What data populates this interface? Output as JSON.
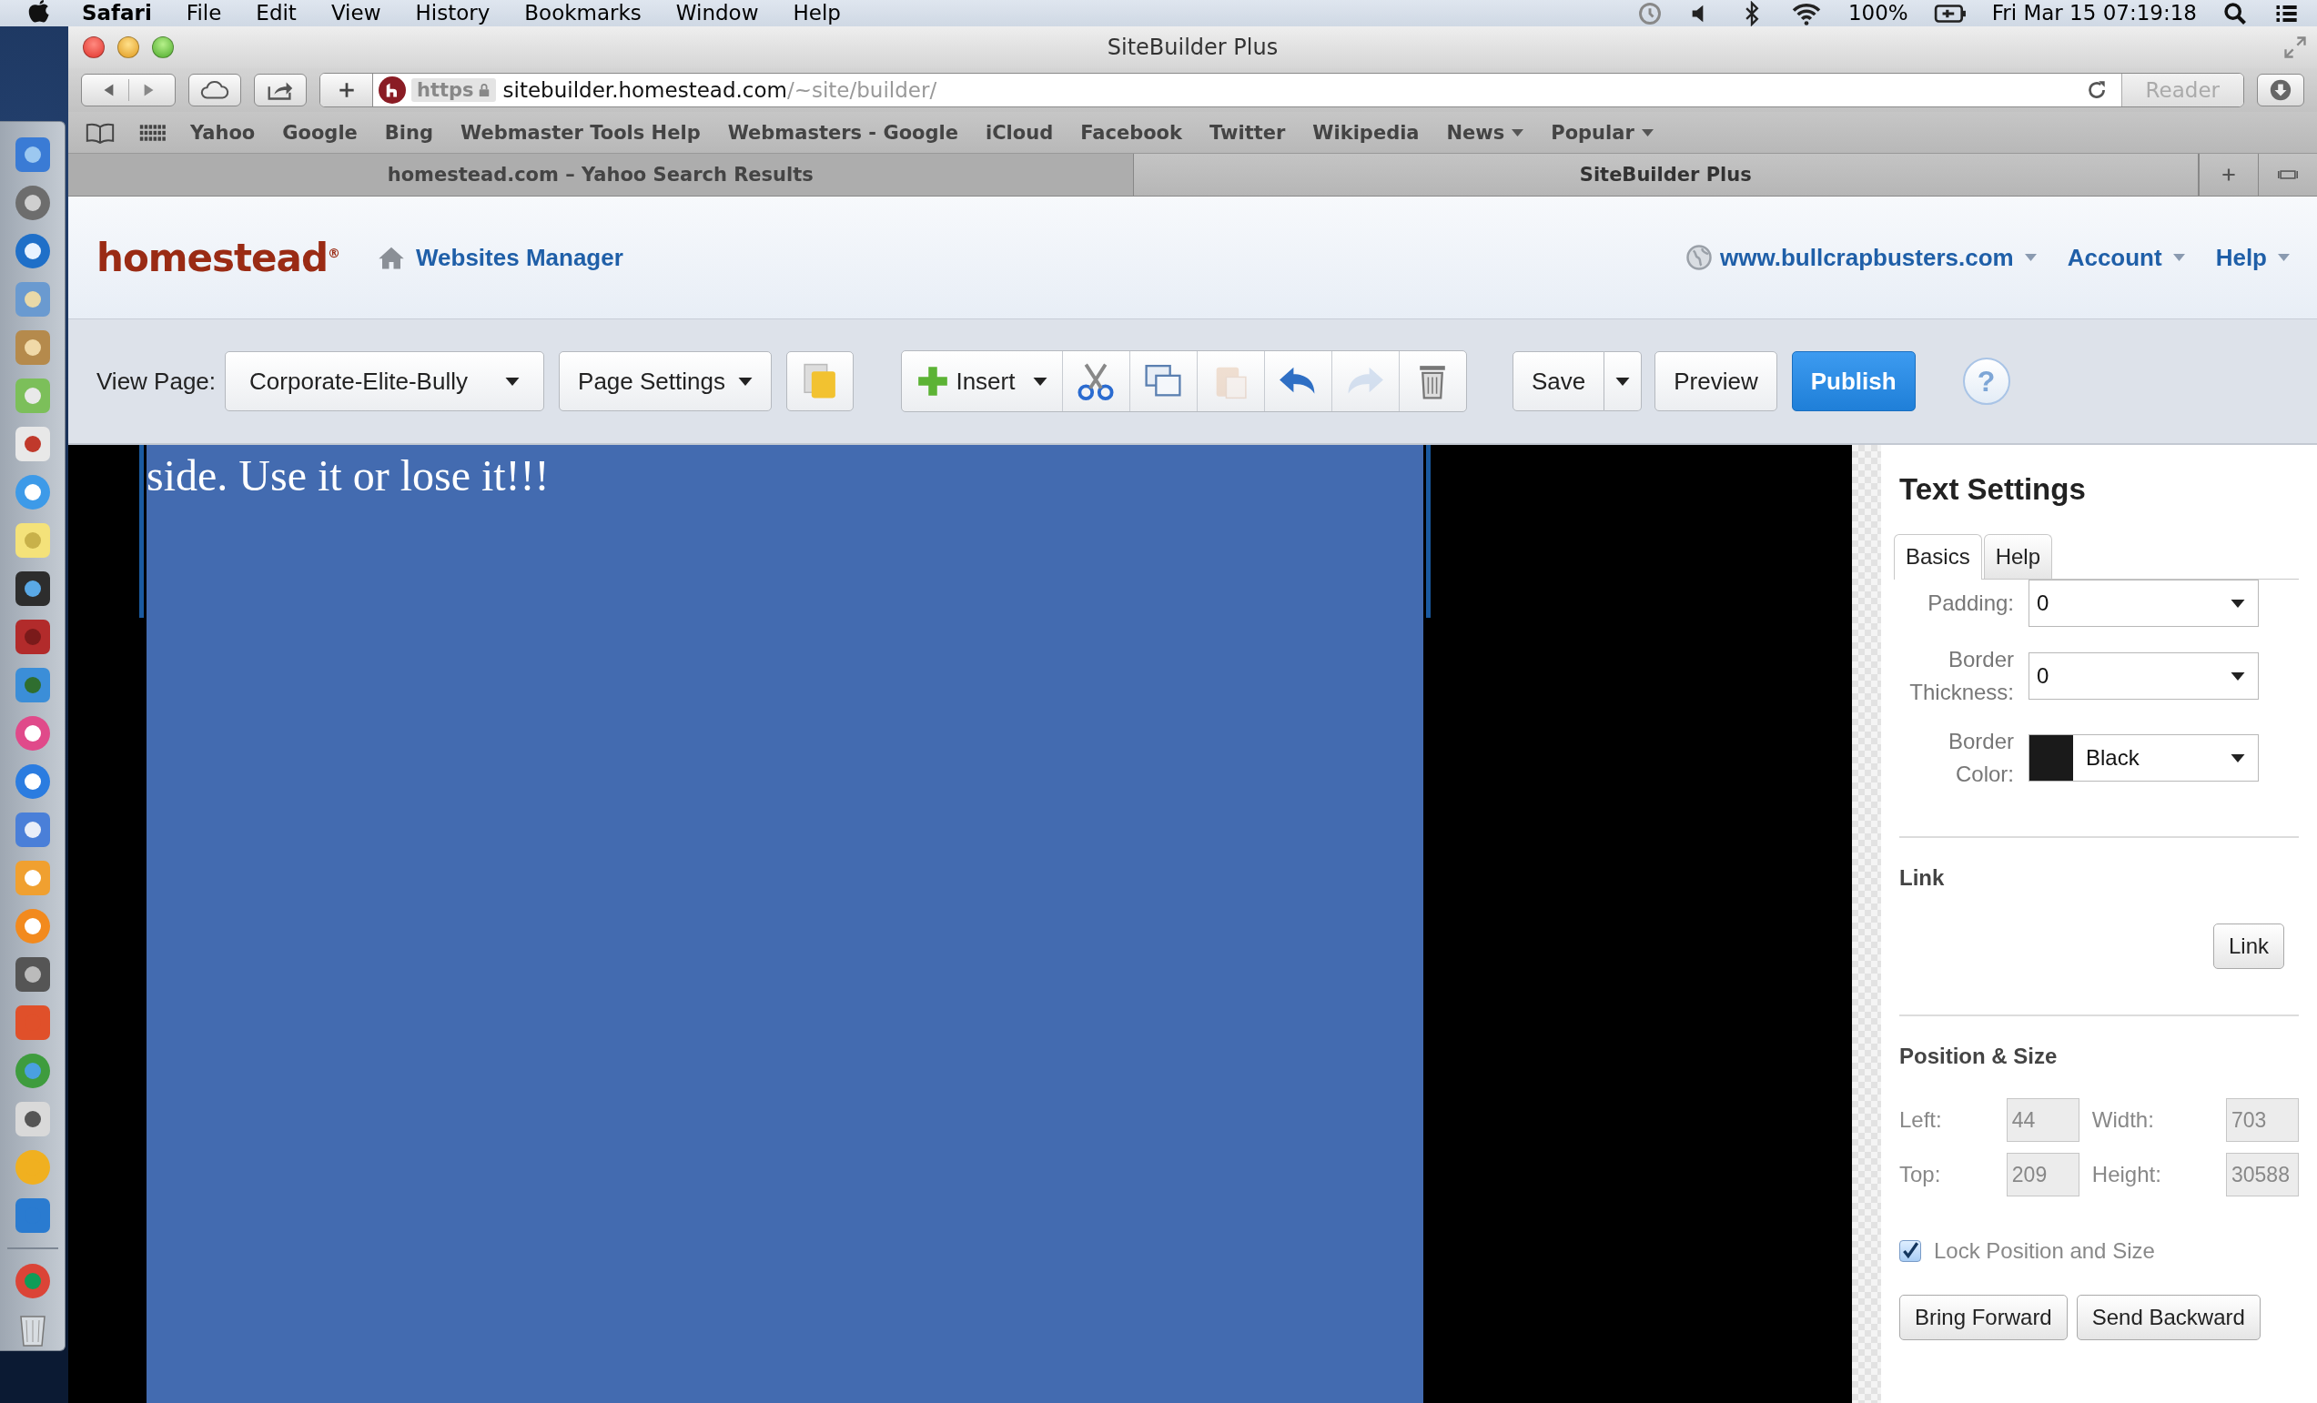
{
  "menu_bar": {
    "app": "Safari",
    "menus": [
      "File",
      "Edit",
      "View",
      "History",
      "Bookmarks",
      "Window",
      "Help"
    ],
    "battery": "100%",
    "clock": "Fri Mar 15  07:19:18"
  },
  "window": {
    "title": "SiteBuilder Plus"
  },
  "address_bar": {
    "scheme": "https",
    "host": "sitebuilder.homestead.com",
    "path": "/~site/builder/",
    "reader": "Reader"
  },
  "bookmarks": [
    {
      "label": "Yahoo",
      "menu": false
    },
    {
      "label": "Google",
      "menu": false
    },
    {
      "label": "Bing",
      "menu": false
    },
    {
      "label": "Webmaster Tools Help",
      "menu": false
    },
    {
      "label": "Webmasters - Google",
      "menu": false
    },
    {
      "label": "iCloud",
      "menu": false
    },
    {
      "label": "Facebook",
      "menu": false
    },
    {
      "label": "Twitter",
      "menu": false
    },
    {
      "label": "Wikipedia",
      "menu": false
    },
    {
      "label": "News",
      "menu": true
    },
    {
      "label": "Popular",
      "menu": true
    }
  ],
  "tabs": [
    {
      "label": "homestead.com – Yahoo Search Results",
      "selected": false
    },
    {
      "label": "SiteBuilder Plus",
      "selected": true
    }
  ],
  "site_header": {
    "logo": "homestead$^{®}$",
    "manager": "Websites Manager",
    "nav": [
      {
        "label": "www.bullcrapbusters.com",
        "kind": "domain"
      },
      {
        "label": "Account",
        "kind": "menu"
      },
      {
        "label": "Help",
        "kind": "menu"
      }
    ]
  },
  "builder_toolbar": {
    "view_page_label": "View Page:",
    "page": "Corporate-Elite-Bully",
    "page_settings": "Page Settings",
    "insert": "Insert",
    "tools": [
      {
        "kind": "cut",
        "disabled": false
      },
      {
        "kind": "copy",
        "disabled": false
      },
      {
        "kind": "paste",
        "disabled": true
      },
      {
        "kind": "undo",
        "disabled": false
      },
      {
        "kind": "redo",
        "disabled": true
      },
      {
        "kind": "delete",
        "disabled": false
      }
    ],
    "save": "Save",
    "preview": "Preview",
    "publish": "Publish",
    "help": "?"
  },
  "canvas": {
    "text": "side. Use it or lose it!!!"
  },
  "text_settings": {
    "title": "Text Settings",
    "tabs": [
      {
        "label": "Basics",
        "selected": true
      },
      {
        "label": "Help",
        "selected": false
      }
    ],
    "fields": [
      {
        "label": "Padding:",
        "value": "0",
        "kind": "select"
      },
      {
        "label": "Border Thickness:",
        "value": "0",
        "kind": "select"
      },
      {
        "label": "Border Color:",
        "value": "Black",
        "kind": "color",
        "color": "#1a1a1a"
      }
    ],
    "link_heading": "Link",
    "link_button": "Link",
    "position_heading": "Position & Size",
    "position": [
      {
        "label": "Left:",
        "value": "44"
      },
      {
        "label": "Width:",
        "value": "703"
      },
      {
        "label": "Top:",
        "value": "209"
      },
      {
        "label": "Height:",
        "value": "30588"
      }
    ],
    "lock": {
      "label": "Lock Position and Size",
      "checked": true
    },
    "buttons": [
      "Bring Forward",
      "Send Backward"
    ]
  }
}
